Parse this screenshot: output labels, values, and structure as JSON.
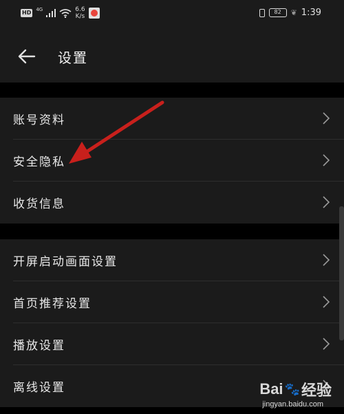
{
  "status_bar": {
    "hd": "HD",
    "network": "4G",
    "speed_value": "6.6",
    "speed_unit": "K/s",
    "battery": "82",
    "time": "1:39"
  },
  "header": {
    "title": "设置"
  },
  "groups": [
    {
      "items": [
        "账号资料",
        "安全隐私",
        "收货信息"
      ]
    },
    {
      "items": [
        "开屏启动画面设置",
        "首页推荐设置",
        "播放设置",
        "离线设置"
      ]
    }
  ],
  "watermark": {
    "brand_left": "Bai",
    "brand_right": "经验",
    "url": "jingyan.baidu.com"
  },
  "colors": {
    "annotation_arrow": "#c8201c",
    "background": "#000000",
    "surface": "#1b1b1b"
  }
}
